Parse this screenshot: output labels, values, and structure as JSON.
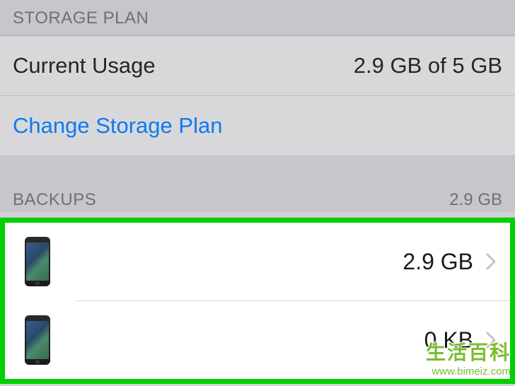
{
  "storage_plan": {
    "header": "STORAGE PLAN",
    "current_usage_label": "Current Usage",
    "current_usage_value": "2.9 GB of 5 GB",
    "change_plan_label": "Change Storage Plan"
  },
  "backups": {
    "header": "BACKUPS",
    "total": "2.9 GB",
    "devices": [
      {
        "icon": "iphone",
        "size": "2.9 GB"
      },
      {
        "icon": "iphone",
        "size": "0 KB"
      }
    ]
  },
  "watermark": {
    "text": "生活百科",
    "url": "www.bimeiz.com"
  }
}
